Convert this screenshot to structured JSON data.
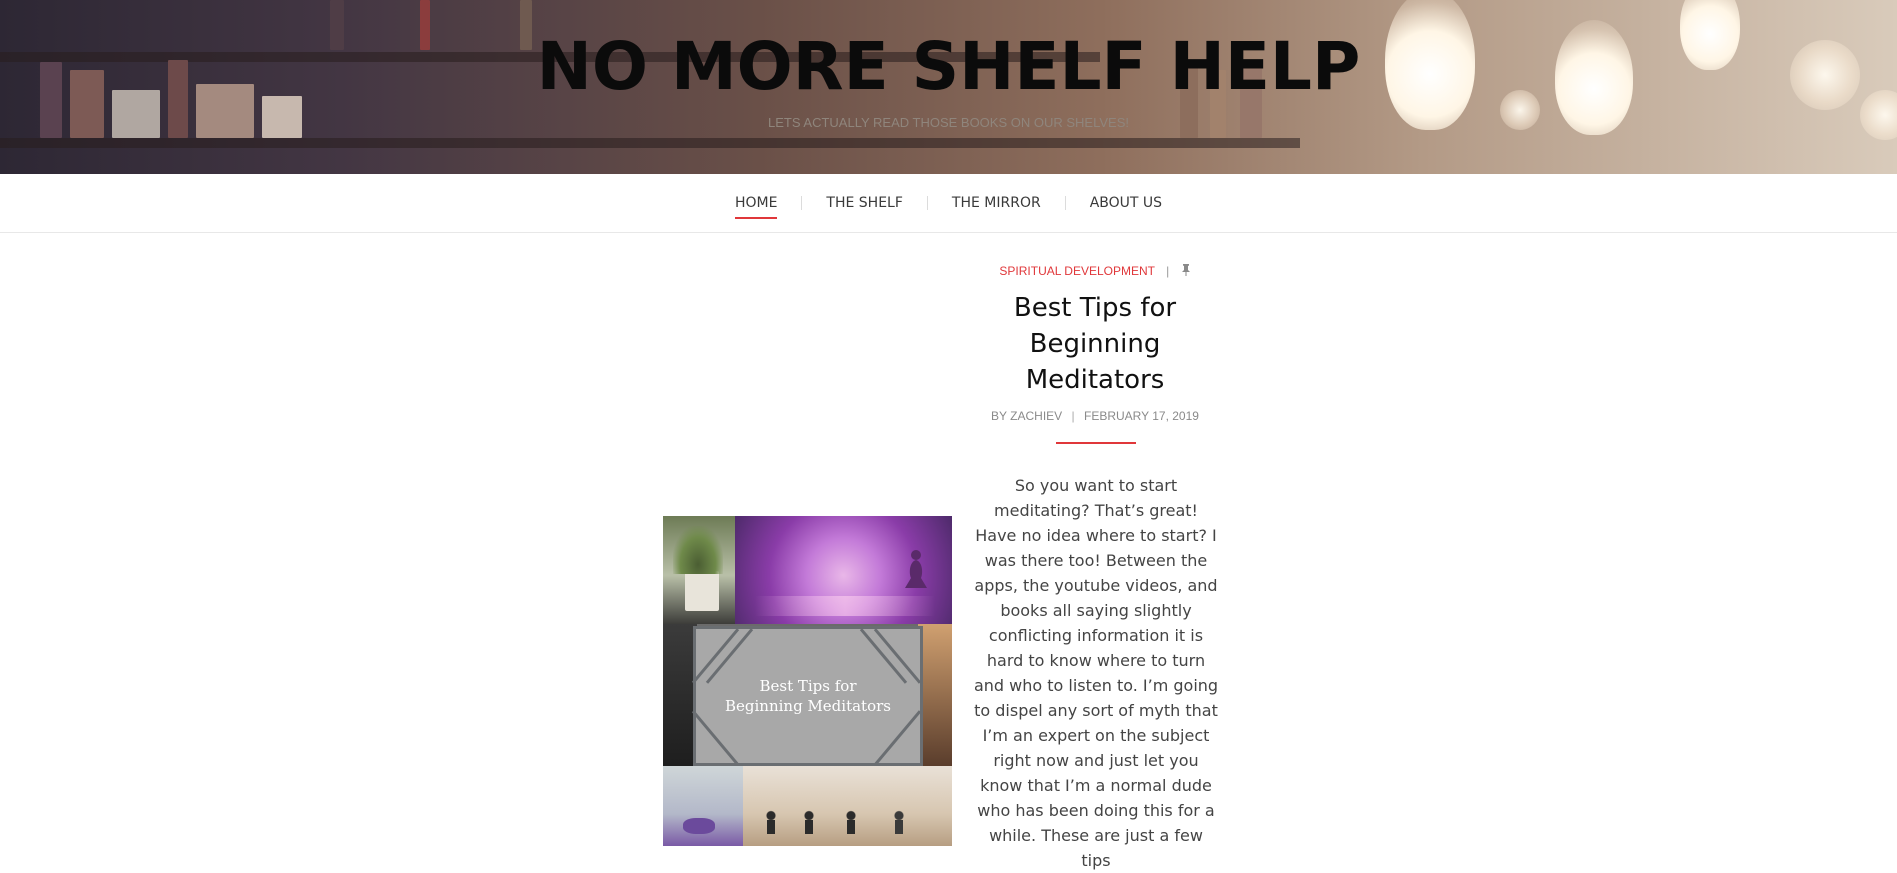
{
  "site": {
    "title": "NO MORE SHELF HELP",
    "tagline": "LETS ACTUALLY READ THOSE BOOKS ON OUR SHELVES!"
  },
  "nav": {
    "items": [
      {
        "label": "HOME",
        "active": true
      },
      {
        "label": "THE SHELF",
        "active": false
      },
      {
        "label": "THE MIRROR",
        "active": false
      },
      {
        "label": "ABOUT US",
        "active": false
      }
    ]
  },
  "post": {
    "category": "SPIRITUAL DEVELOPMENT",
    "meta_separator": "|",
    "pin_icon": "pin-icon",
    "title": "Best Tips for Beginning Meditators",
    "byline_prefix": "BY",
    "author": "ZACHIEV",
    "date": "FEBRUARY 17, 2019",
    "excerpt": "So you want to start meditating? That’s great! Have no idea where to start? I was there too! Between the apps, the youtube videos, and books all saying slightly conflicting information it is hard to know where to turn and who to listen to. I’m going to dispel any sort of myth that I’m an expert on the subject right now and just let you know that I’m a normal dude who has been doing this for a while. These are just a few tips",
    "image_caption": "Best Tips for Beginning Meditators"
  },
  "colors": {
    "accent": "#e0373a",
    "title": "#0b0b0b",
    "text": "#444444"
  }
}
